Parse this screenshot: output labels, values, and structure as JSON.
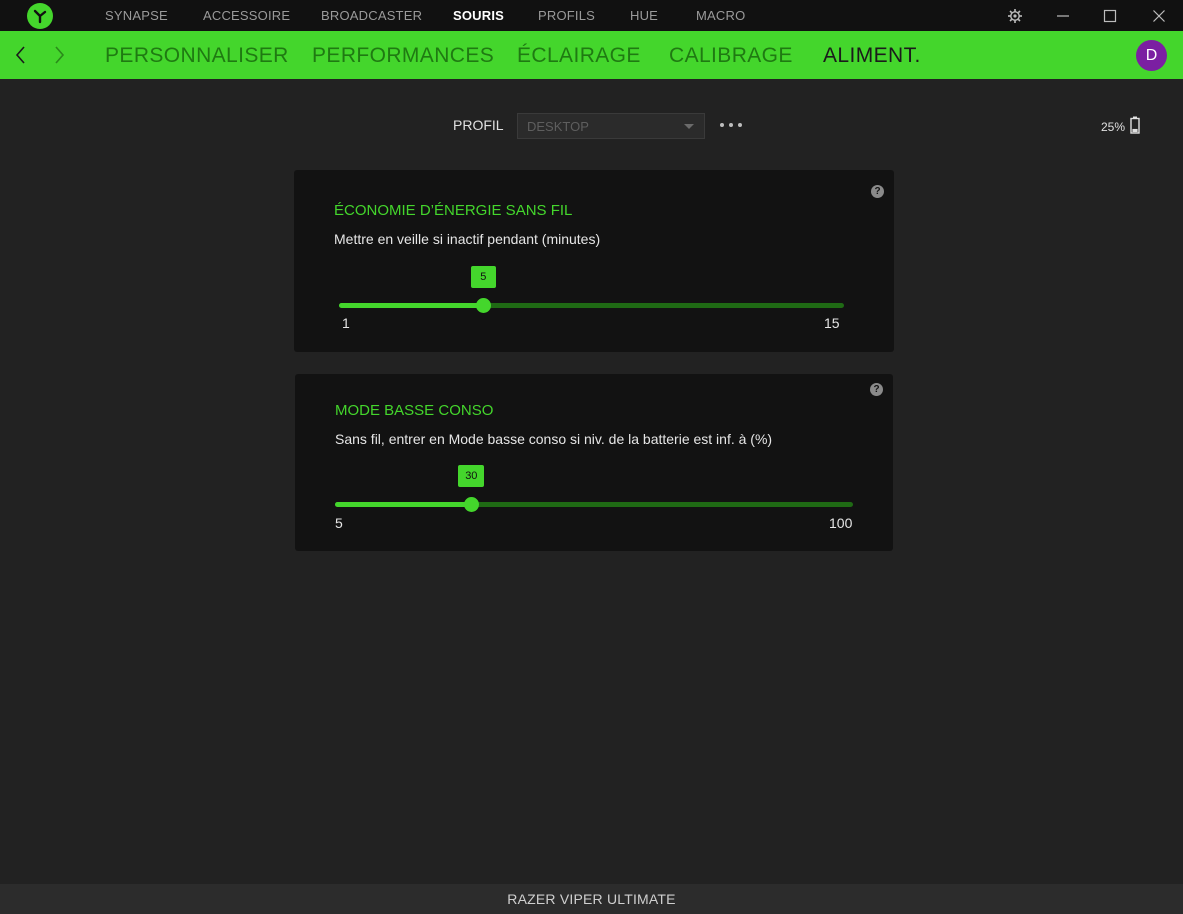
{
  "topnav": {
    "items": [
      {
        "label": "SYNAPSE"
      },
      {
        "label": "ACCESSOIRE"
      },
      {
        "label": "BROADCASTER"
      },
      {
        "label": "SOURIS",
        "active": true
      },
      {
        "label": "PROFILS"
      },
      {
        "label": "HUE"
      },
      {
        "label": "MACRO"
      }
    ]
  },
  "subnav": {
    "items": [
      {
        "label": "PERSONNALISER"
      },
      {
        "label": "PERFORMANCES"
      },
      {
        "label": "ÉCLAIRAGE"
      },
      {
        "label": "CALIBRAGE"
      },
      {
        "label": "ALIMENT.",
        "active": true
      }
    ],
    "avatar_initial": "D"
  },
  "profile": {
    "label": "PROFIL",
    "selected": "DESKTOP"
  },
  "battery": {
    "level_text": "25%",
    "level": 25
  },
  "power_saving": {
    "title": "ÉCONOMIE D’ÉNERGIE SANS FIL",
    "description": "Mettre en veille si inactif pendant (minutes)",
    "value": "5",
    "min": "1",
    "max": "15",
    "help": "?"
  },
  "low_power": {
    "title": "MODE BASSE CONSO",
    "description": "Sans fil, entrer en Mode basse conso si niv. de la batterie est inf. à (%)",
    "value": "30",
    "min": "5",
    "max": "100",
    "help": "?"
  },
  "footer": {
    "device_name": "RAZER VIPER ULTIMATE"
  },
  "colors": {
    "accent": "#44d62c",
    "avatar": "#7b1fa2"
  },
  "icons": [
    "razer-logo-icon",
    "settings-gear-icon",
    "minimize-icon",
    "maximize-icon",
    "close-icon",
    "back-arrow-icon",
    "forward-arrow-icon",
    "more-dots-icon",
    "battery-icon",
    "help-icon",
    "dropdown-caret-icon"
  ]
}
